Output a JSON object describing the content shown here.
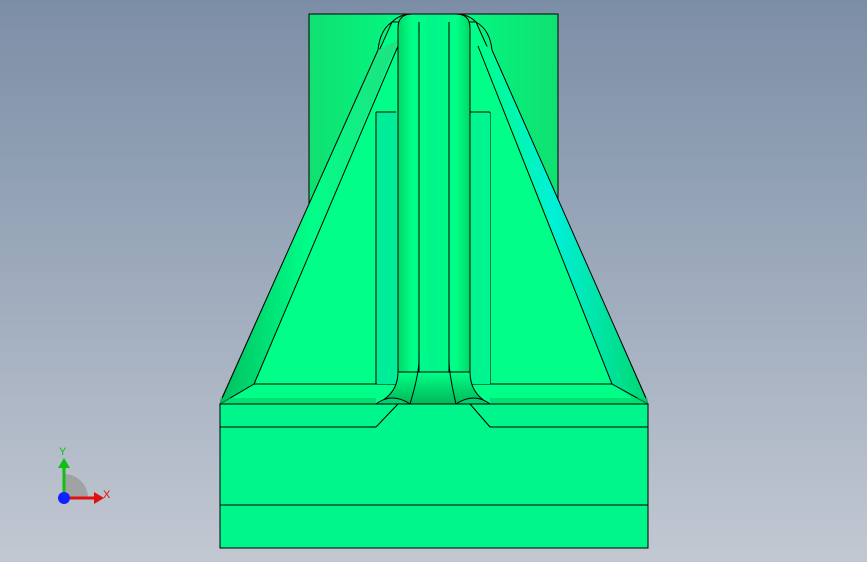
{
  "viewport": {
    "background_top": "#7c8ea6",
    "background_bottom": "#c2c8d2"
  },
  "part": {
    "name": "bracket-part",
    "face_color": "#00ff88",
    "highlight_color": "#00f5c8",
    "edge_color": "#000000"
  },
  "triad": {
    "x_label": "X",
    "y_label": "Y",
    "x_color": "#e01010",
    "y_color": "#10c010",
    "z_color": "#1020ff"
  }
}
